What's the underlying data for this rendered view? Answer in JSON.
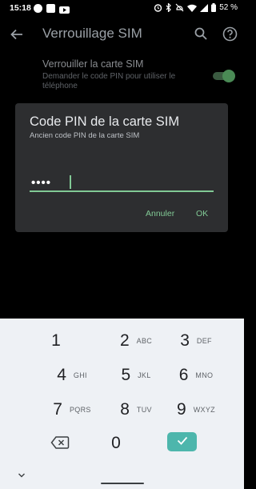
{
  "status_bar": {
    "time": "15:18",
    "battery_text": "52 %",
    "icons": [
      "app-notification-icon",
      "image-notification-icon",
      "youtube-notification-icon",
      "alarm-icon",
      "bluetooth-icon",
      "do-not-disturb-off-icon",
      "wifi-icon",
      "signal-icon",
      "battery-icon"
    ]
  },
  "app_bar": {
    "title": "Verrouillage SIM",
    "icons": [
      "back-arrow-icon",
      "search-icon",
      "help-icon"
    ]
  },
  "setting": {
    "title": "Verrouiller la carte SIM",
    "summary": "Demander le code PIN pour utiliser le téléphone",
    "toggle_on": true
  },
  "dialog": {
    "title": "Code PIN de la carte SIM",
    "subtitle": "Ancien code PIN de la carte SIM",
    "pin_value": "••••",
    "cancel_label": "Annuler",
    "ok_label": "OK",
    "accent_color": "#81c995"
  },
  "keyboard": {
    "keys": [
      {
        "num": "1",
        "letters": ""
      },
      {
        "num": "2",
        "letters": "ABC"
      },
      {
        "num": "3",
        "letters": "DEF"
      },
      {
        "num": "4",
        "letters": "GHI"
      },
      {
        "num": "5",
        "letters": "JKL"
      },
      {
        "num": "6",
        "letters": "MNO"
      },
      {
        "num": "7",
        "letters": "PQRS"
      },
      {
        "num": "8",
        "letters": "TUV"
      },
      {
        "num": "9",
        "letters": "WXYZ"
      },
      {
        "num": "0",
        "letters": ""
      }
    ],
    "enter_color": "#4db6ac"
  }
}
